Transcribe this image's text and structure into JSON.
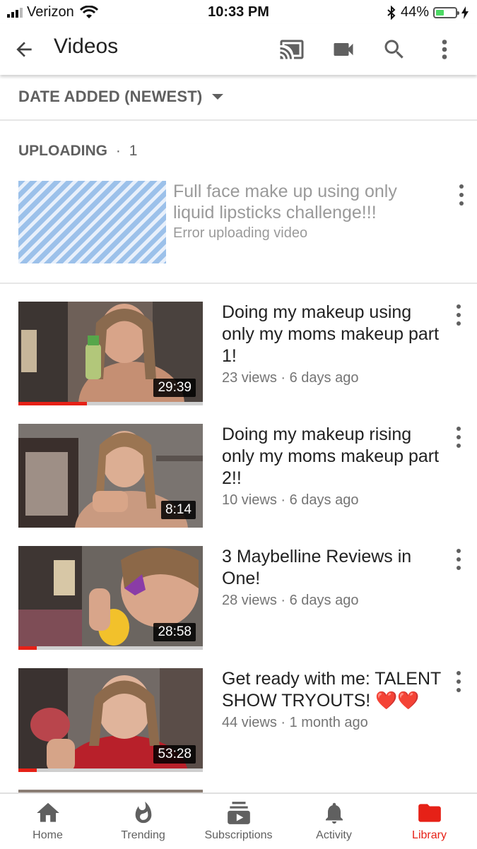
{
  "status_bar": {
    "carrier": "Verizon",
    "time": "10:33 PM",
    "battery": "44%",
    "battery_level": 0.44
  },
  "app_bar": {
    "title": "Videos",
    "icons": [
      "back-arrow-icon",
      "cast-icon",
      "camera-icon",
      "search-icon",
      "more-vert-icon"
    ]
  },
  "sort": {
    "label": "DATE ADDED (NEWEST)"
  },
  "uploading": {
    "header": "UPLOADING",
    "separator": "·",
    "count": "1",
    "item": {
      "title": "Full face make up using only liquid lipsticks challenge!!!",
      "status": "Error uploading video"
    }
  },
  "videos": [
    {
      "title": "Doing my makeup using only my moms makeup part 1!",
      "meta": "23 views · 6 days ago",
      "duration": "29:39",
      "progress": 0.37
    },
    {
      "title": "Doing my makeup rising only my moms makeup part 2!!",
      "meta": "10 views · 6 days ago",
      "duration": "8:14",
      "progress": 0
    },
    {
      "title": "3 Maybelline Reviews in One!",
      "meta": "28 views · 6 days ago",
      "duration": "28:58",
      "progress": 0.1
    },
    {
      "title": "Get ready with me: TALENT SHOW TRYOUTS! ❤️❤️",
      "meta": "44 views · 1 month ago",
      "duration": "53:28",
      "progress": 0.1
    }
  ],
  "bottom_nav": [
    {
      "label": "Home",
      "icon": "home-icon"
    },
    {
      "label": "Trending",
      "icon": "flame-icon"
    },
    {
      "label": "Subscriptions",
      "icon": "subscriptions-icon"
    },
    {
      "label": "Activity",
      "icon": "bell-icon"
    },
    {
      "label": "Library",
      "icon": "folder-icon",
      "active": true
    }
  ],
  "colors": {
    "accent": "#e62117",
    "text": "#212121",
    "secondary": "#606060",
    "upload_stripe": "#9cc1ea"
  }
}
